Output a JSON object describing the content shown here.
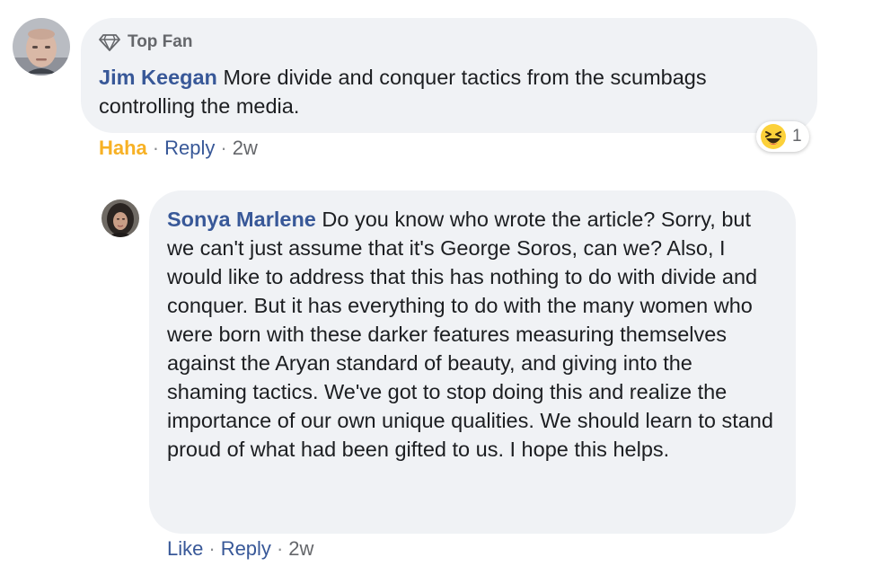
{
  "comment_1": {
    "badge_label": "Top Fan",
    "author": "Jim Keegan",
    "text": " More divide and conquer tactics from the scumbags controlling the media.",
    "reaction": {
      "icon": "haha-emoji-icon",
      "count": "1"
    },
    "actions": {
      "haha": "Haha",
      "reply": "Reply",
      "time": "2w"
    }
  },
  "comment_2": {
    "author": "Sonya Marlene",
    "text": " Do you know who wrote the article? Sorry, but we can't just assume that it's George Soros, can we? Also, I would like to address that this has nothing to do with divide and conquer. But it has everything to do with the many women who were born with these darker features measuring themselves against the Aryan standard of beauty, and giving into the shaming tactics. We've got to stop doing this and realize the importance of our own unique qualities. We should learn to stand proud of what had been gifted to us. I hope this helps.",
    "actions": {
      "like": "Like",
      "reply": "Reply",
      "time": "2w"
    }
  },
  "separator": "·",
  "colors": {
    "bubble": "#f0f2f5",
    "link_blue": "#385898",
    "haha_yellow": "#f7b125",
    "meta_gray": "#65676b"
  }
}
